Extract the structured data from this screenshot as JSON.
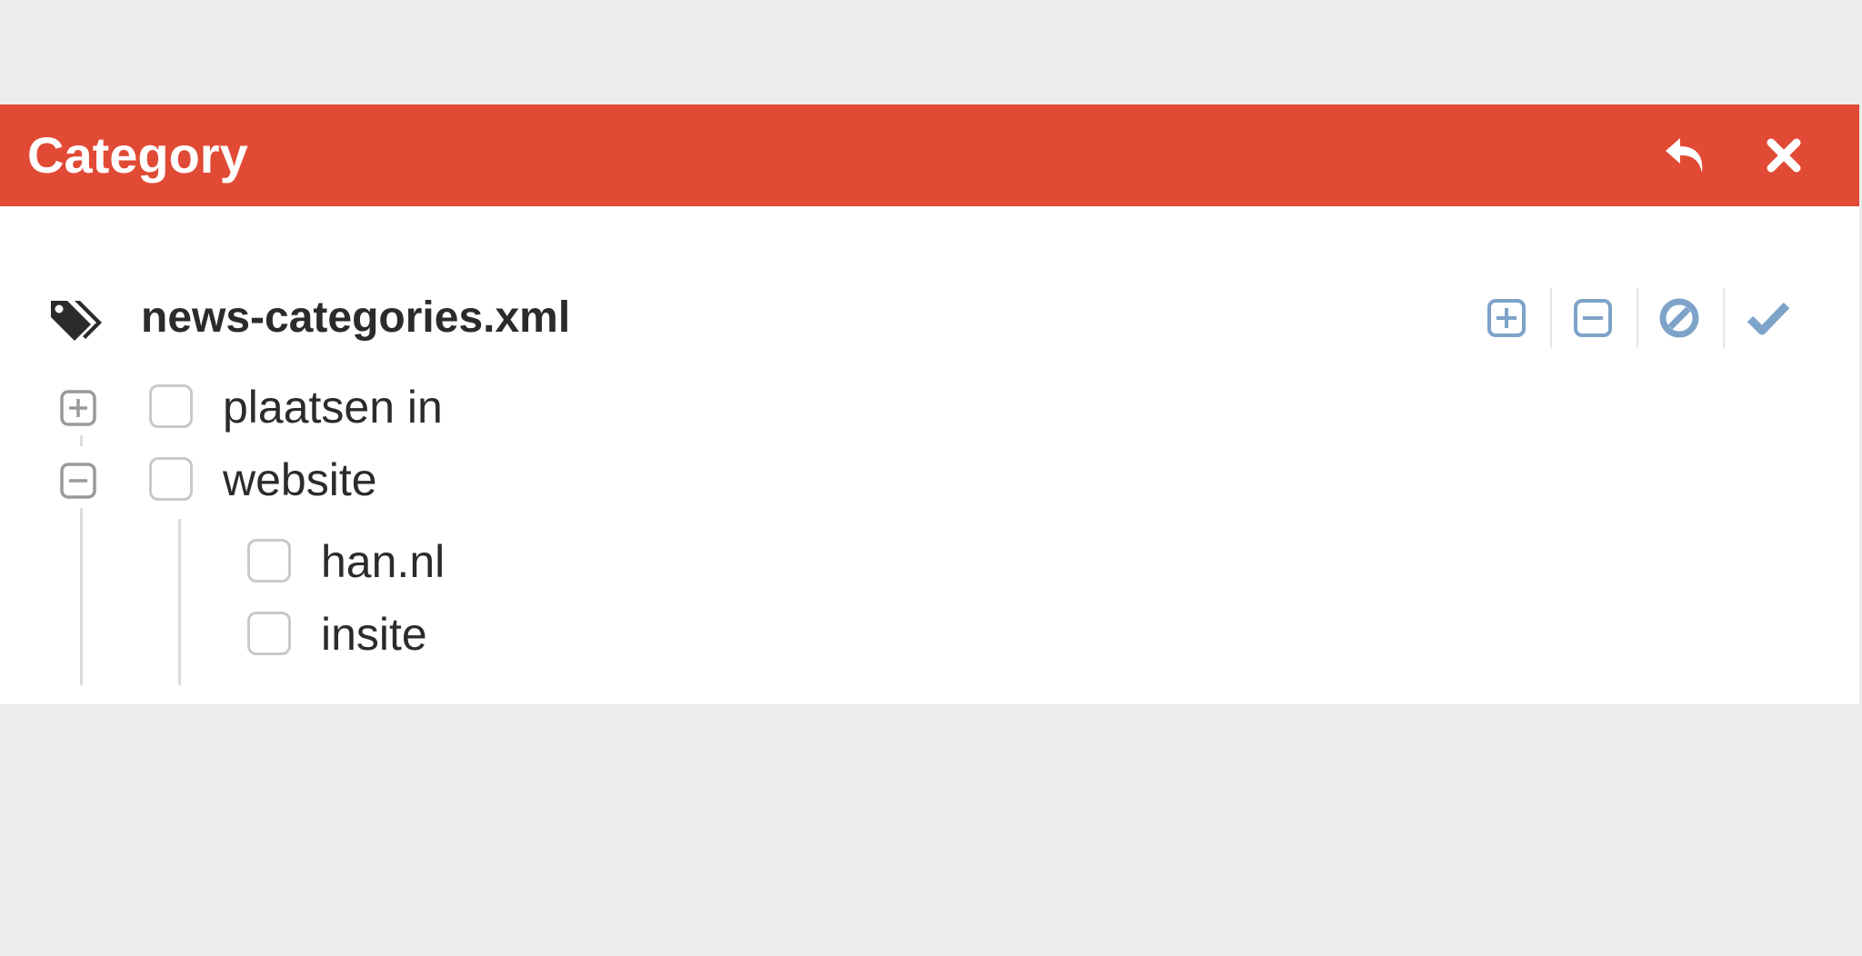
{
  "dialog": {
    "title": "Category",
    "accent_color": "#e14a35"
  },
  "header_actions": {
    "back_icon": "reply-icon",
    "close_icon": "close-icon"
  },
  "file": {
    "icon": "tags-icon",
    "name": "news-categories.xml"
  },
  "toolbar": {
    "icons": [
      "plus-square-icon",
      "minus-square-icon",
      "ban-icon",
      "check-icon"
    ],
    "color": "#7ea3c9"
  },
  "tree": {
    "nodes": [
      {
        "label": "plaatsen in",
        "expanded": false,
        "checked": false,
        "children": []
      },
      {
        "label": "website",
        "expanded": true,
        "checked": false,
        "children": [
          {
            "label": "han.nl",
            "checked": false
          },
          {
            "label": "insite",
            "checked": false
          }
        ]
      }
    ]
  }
}
